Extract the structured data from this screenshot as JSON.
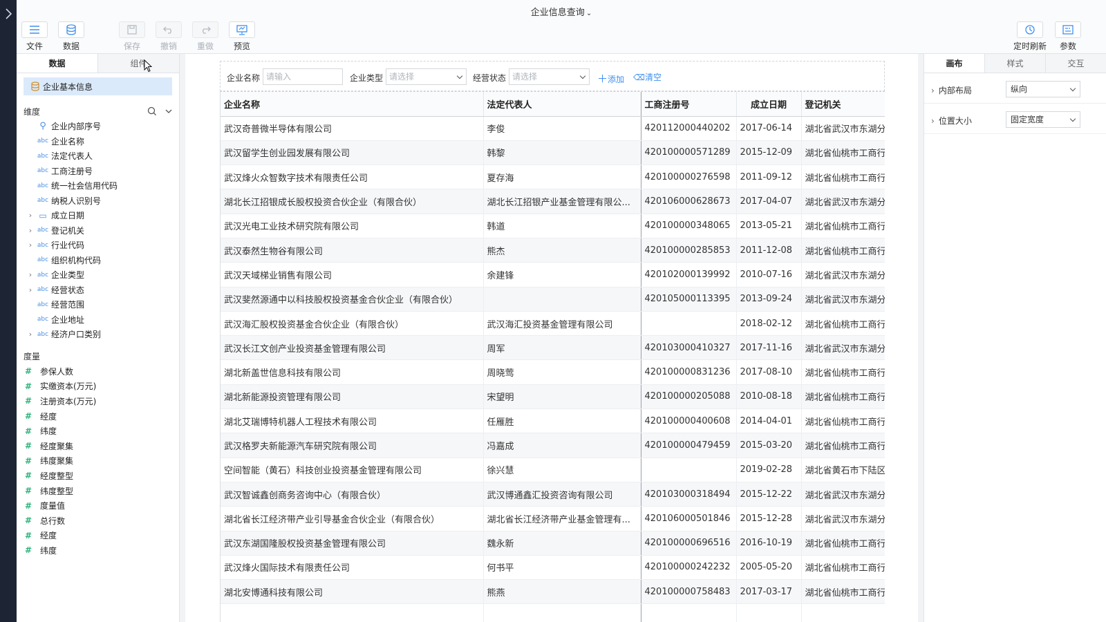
{
  "window": {
    "title": "企业信息查询"
  },
  "toolbar": {
    "left": [
      {
        "label": "文件",
        "icon": "menu-icon"
      },
      {
        "label": "数据",
        "icon": "database-icon"
      },
      {
        "label": "保存",
        "icon": "save-icon"
      },
      {
        "label": "撤销",
        "icon": "undo-icon"
      },
      {
        "label": "重做",
        "icon": "redo-icon"
      },
      {
        "label": "预览",
        "icon": "preview-icon"
      }
    ],
    "right": [
      {
        "label": "定时刷新",
        "icon": "clock-refresh-icon"
      },
      {
        "label": "参数",
        "icon": "parameter-icon"
      }
    ]
  },
  "left_panel": {
    "tabs": [
      "数据",
      "组件"
    ],
    "dataset": "企业基本信息",
    "dimension_title": "维度",
    "dimensions": [
      {
        "label": "企业内部序号",
        "type": "key",
        "expandable": false
      },
      {
        "label": "企业名称",
        "type": "abc",
        "expandable": false
      },
      {
        "label": "法定代表人",
        "type": "abc",
        "expandable": false
      },
      {
        "label": "工商注册号",
        "type": "abc",
        "expandable": false
      },
      {
        "label": "统一社会信用代码",
        "type": "abc",
        "expandable": false
      },
      {
        "label": "纳税人识别号",
        "type": "abc",
        "expandable": false
      },
      {
        "label": "成立日期",
        "type": "date",
        "expandable": true
      },
      {
        "label": "登记机关",
        "type": "abc",
        "expandable": true
      },
      {
        "label": "行业代码",
        "type": "abc",
        "expandable": true
      },
      {
        "label": "组织机构代码",
        "type": "abc",
        "expandable": false
      },
      {
        "label": "企业类型",
        "type": "abc",
        "expandable": true
      },
      {
        "label": "经营状态",
        "type": "abc",
        "expandable": true
      },
      {
        "label": "经营范围",
        "type": "abc",
        "expandable": false
      },
      {
        "label": "企业地址",
        "type": "abc",
        "expandable": false
      },
      {
        "label": "经济户口类别",
        "type": "abc",
        "expandable": true
      }
    ],
    "measure_title": "度量",
    "measures": [
      "参保人数",
      "实缴资本(万元)",
      "注册资本(万元)",
      "经度",
      "纬度",
      "经度聚集",
      "纬度聚集",
      "经度整型",
      "纬度整型",
      "度量值",
      "总行数",
      "经度",
      "纬度"
    ]
  },
  "filter": {
    "name_label": "企业名称",
    "name_placeholder": "请输入",
    "type_label": "企业类型",
    "type_placeholder": "请选择",
    "status_label": "经营状态",
    "status_placeholder": "请选择",
    "add_label": "添加",
    "clear_label": "清空"
  },
  "table": {
    "columns": [
      "企业名称",
      "法定代表人",
      "工商注册号",
      "成立日期",
      "登记机关"
    ],
    "rows": [
      [
        "武汉奇普微半导体有限公司",
        "李俊",
        "420112000440202",
        "2017-06-14",
        "湖北省武汉市东湖分"
      ],
      [
        "武汉留学生创业园发展有限公司",
        "韩黎",
        "420100000571289",
        "2015-12-09",
        "湖北省仙桃市工商行"
      ],
      [
        "武汉烽火众智数字技术有限责任公司",
        "夏存海",
        "420100000276598",
        "2011-09-12",
        "湖北省仙桃市工商行"
      ],
      [
        "湖北长江招银成长股权投资合伙企业（有限合伙）",
        "湖北长江招银产业基金管理有限公...",
        "420106000628673",
        "2017-04-07",
        "湖北省武汉市东湖分"
      ],
      [
        "武汉光电工业技术研究院有限公司",
        "韩道",
        "420100000348065",
        "2013-05-21",
        "湖北省仙桃市工商行"
      ],
      [
        "武汉泰然生物谷有限公司",
        "熊杰",
        "420100000285853",
        "2011-12-08",
        "湖北省仙桃市工商行"
      ],
      [
        "武汉天域梯业销售有限公司",
        "余建锋",
        "420102000139992",
        "2010-07-16",
        "湖北省武汉市东湖分"
      ],
      [
        "武汉斐然源通中以科技股权投资基金合伙企业（有限合伙）",
        "",
        "420105000113395",
        "2013-09-24",
        "湖北省武汉市东湖分"
      ],
      [
        "武汉海汇股权投资基金合伙企业（有限合伙）",
        "武汉海汇投资基金管理有限公司",
        "",
        "2018-02-12",
        "湖北省仙桃市工商行"
      ],
      [
        "武汉长江文创产业投资基金管理有限公司",
        "周军",
        "420103000410327",
        "2017-11-16",
        "湖北省武汉市东湖分"
      ],
      [
        "湖北新盖世信息科技有限公司",
        "周晓莺",
        "420100000831236",
        "2017-08-10",
        "湖北省仙桃市工商行"
      ],
      [
        "湖北新能源投资管理有限公司",
        "宋望明",
        "420100000205088",
        "2010-08-18",
        "湖北省仙桃市工商行"
      ],
      [
        "湖北艾瑞博特机器人工程技术有限公司",
        "任雁胜",
        "420100000400608",
        "2014-04-01",
        "湖北省仙桃市工商行"
      ],
      [
        "武汉格罗夫新能源汽车研究院有限公司",
        "冯嘉成",
        "420100000479459",
        "2015-03-20",
        "湖北省仙桃市工商行"
      ],
      [
        "空间智能（黄石）科技创业投资基金管理有限公司",
        "徐兴慧",
        "",
        "2019-02-28",
        "湖北省黄石市下陆区"
      ],
      [
        "武汉智诚鑫创商务咨询中心（有限合伙）",
        "武汉博通鑫汇投资咨询有限公司",
        "420103000318494",
        "2015-12-22",
        "湖北省武汉市东湖分"
      ],
      [
        "湖北省长江经济带产业引导基金合伙企业（有限合伙）",
        "湖北省长江经济带产业基金管理有...",
        "420106000501846",
        "2015-12-28",
        "湖北省武汉市东湖分"
      ],
      [
        "武汉东湖国隆股权投资基金管理有限公司",
        "魏永新",
        "420100000696516",
        "2016-10-19",
        "湖北省仙桃市工商行"
      ],
      [
        "武汉烽火国际技术有限责任公司",
        "何书平",
        "420100000242232",
        "2005-05-20",
        "湖北省仙桃市工商行"
      ],
      [
        "湖北安博通科技有限公司",
        "熊燕",
        "420100000758483",
        "2017-03-17",
        "湖北省仙桃市工商行"
      ],
      [
        "",
        "",
        "",
        "",
        ""
      ]
    ]
  },
  "right_panel": {
    "tabs": [
      "画布",
      "样式",
      "交互"
    ],
    "props": [
      {
        "label": "内部布局",
        "value": "纵向"
      },
      {
        "label": "位置大小",
        "value": "固定宽度"
      }
    ]
  },
  "colors": {
    "accent": "#3d8ff0",
    "selected_bg": "#dbeafb",
    "sidebar_dark": "#1d2535",
    "measure_green": "#2db37a"
  }
}
